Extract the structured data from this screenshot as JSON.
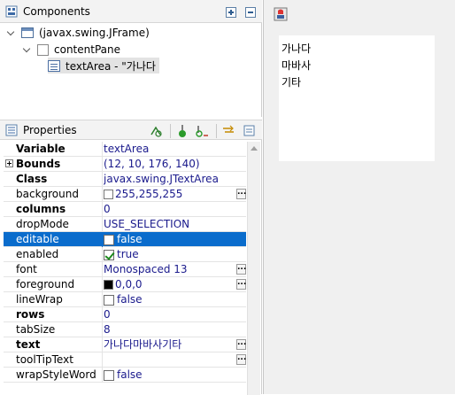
{
  "components": {
    "title": "Components",
    "tree": [
      {
        "label": "(javax.swing.JFrame)"
      },
      {
        "label": "contentPane"
      },
      {
        "label": "textArea - \"가나다"
      }
    ]
  },
  "properties": {
    "title": "Properties",
    "rows": [
      {
        "name": "Variable",
        "value": "textArea"
      },
      {
        "name": "Bounds",
        "value": "(12, 10, 176, 140)"
      },
      {
        "name": "Class",
        "value": "javax.swing.JTextArea"
      },
      {
        "name": "background",
        "value": "255,255,255",
        "swatch": "#ffffff"
      },
      {
        "name": "columns",
        "value": "0"
      },
      {
        "name": "dropMode",
        "value": "USE_SELECTION"
      },
      {
        "name": "editable",
        "value": "false"
      },
      {
        "name": "enabled",
        "value": "true"
      },
      {
        "name": "font",
        "value": "Monospaced 13"
      },
      {
        "name": "foreground",
        "value": "0,0,0",
        "swatch": "#000000"
      },
      {
        "name": "lineWrap",
        "value": "false"
      },
      {
        "name": "rows",
        "value": "0"
      },
      {
        "name": "tabSize",
        "value": "8"
      },
      {
        "name": "text",
        "value": "가나다마바사기타"
      },
      {
        "name": "toolTipText",
        "value": ""
      },
      {
        "name": "wrapStyleWord",
        "value": "false"
      }
    ]
  },
  "design": {
    "textarea_lines": [
      "가나다",
      "마바사",
      "기타"
    ]
  },
  "colors": {
    "selection": "#0a6ccc",
    "value_text": "#1a1a8c"
  }
}
